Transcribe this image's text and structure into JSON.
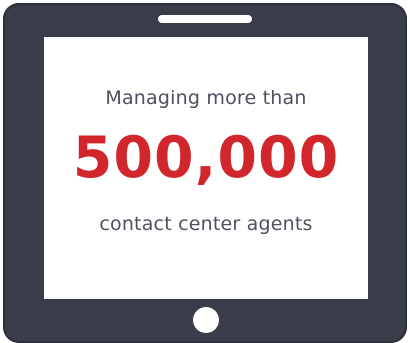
{
  "message": {
    "line_top": "Managing more than",
    "number": "500,000",
    "line_bottom": "contact center agents"
  },
  "colors": {
    "frame": "#393c49",
    "screen": "#ffffff",
    "accent": "#d0262c",
    "text": "#4e505d"
  },
  "icons": {
    "speaker": "speaker-slot-icon",
    "home": "home-button-icon"
  }
}
